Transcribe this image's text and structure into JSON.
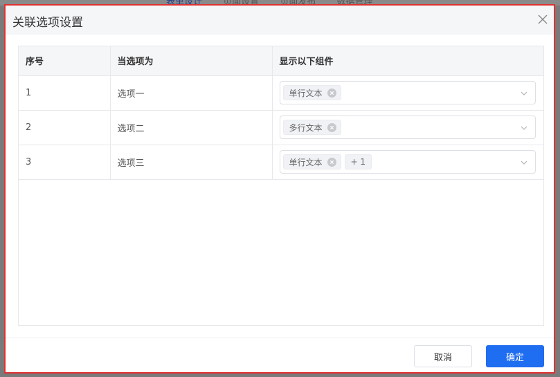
{
  "background": {
    "tabs": [
      "表单设计",
      "页面设置",
      "页面发布",
      "数据管理"
    ]
  },
  "dialog": {
    "title": "关联选项设置",
    "close_icon": "close-icon",
    "table": {
      "columns": [
        "序号",
        "当选项为",
        "显示以下组件"
      ],
      "rows": [
        {
          "index": "1",
          "option": "选项一",
          "tags": [
            "单行文本"
          ],
          "extra": ""
        },
        {
          "index": "2",
          "option": "选项二",
          "tags": [
            "多行文本"
          ],
          "extra": ""
        },
        {
          "index": "3",
          "option": "选项三",
          "tags": [
            "单行文本"
          ],
          "extra": "+ 1"
        }
      ]
    },
    "footer": {
      "cancel_label": "取消",
      "ok_label": "确定"
    }
  },
  "colors": {
    "accent": "#1f6df0",
    "highlight_border": "#e0302f",
    "header_bg": "#f5f6f8"
  }
}
